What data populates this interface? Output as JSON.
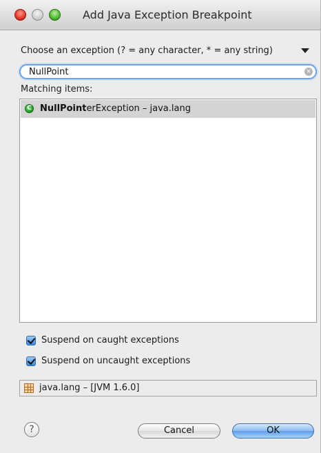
{
  "window": {
    "title": "Add Java Exception Breakpoint"
  },
  "chooser": {
    "prompt": "Choose an exception (? = any character, * = any string)",
    "search_value": "NullPoint",
    "matching_label": "Matching items:",
    "items": [
      {
        "match": "NullPoint",
        "rest": "erException",
        "package": " – java.lang",
        "icon": "class-icon"
      }
    ]
  },
  "options": {
    "caught_label": "Suspend on caught exceptions",
    "caught_checked": true,
    "uncaught_label": "Suspend on uncaught exceptions",
    "uncaught_checked": true
  },
  "status": {
    "text": "java.lang – [JVM 1.6.0]",
    "icon": "package-icon"
  },
  "buttons": {
    "cancel": "Cancel",
    "ok": "OK",
    "help_glyph": "?"
  },
  "colors": {
    "focus": "#6ea4e6",
    "selection": "#d4d4d4",
    "default_button": "#5f9ee6"
  }
}
